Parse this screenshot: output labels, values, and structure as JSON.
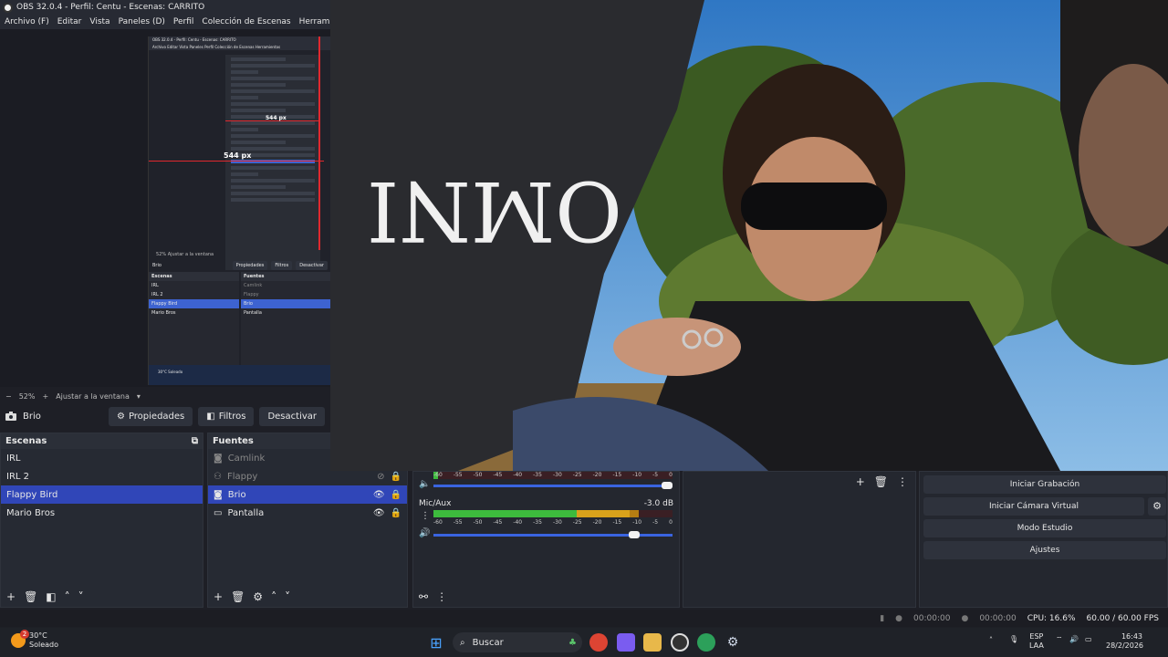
{
  "window": {
    "title": "OBS 32.0.4 - Perfil: Centu - Escenas: CARRITO"
  },
  "menu": [
    "Archivo (F)",
    "Editar",
    "Vista",
    "Paneles (D)",
    "Perfil",
    "Colección de Escenas",
    "Herramientas"
  ],
  "nested_capture": {
    "title": "OBS 32.0.4 - Perfil: Centu - Escenas: CARRITO",
    "menu": "Archivo  Editar  Vista  Paneles  Perfil  Colección de Escenas  Herramientas",
    "measure_label_small": "544 px",
    "measure_label_large": "544 px",
    "zoom_text": "52%   Ajustar a la ventana",
    "source_name": "Brio",
    "buttons": [
      "Propiedades",
      "Filtros",
      "Desactivar"
    ],
    "scenes_header": "Escenas",
    "sources_header": "Fuentes",
    "scenes": [
      "IRL",
      "IRL 2",
      "Flappy Bird",
      "Mario Bros"
    ],
    "sources": [
      "Camlink",
      "Flappy",
      "Brio",
      "Pantalla"
    ],
    "status_temp": "30°C",
    "status_weather": "Soleado"
  },
  "zoom": {
    "minus": "−",
    "value": "52%",
    "plus": "+",
    "fit_label": "Ajustar a la ventana",
    "dropdown": "▾"
  },
  "source_toolbar": {
    "selected_source": "Brio",
    "properties": "Propiedades",
    "filters": "Filtros",
    "deactivate": "Desactivar"
  },
  "scenes": {
    "header": "Escenas",
    "items": [
      "IRL",
      "IRL 2",
      "Flappy Bird",
      "Mario Bros"
    ],
    "selected_index": 2
  },
  "sources": {
    "header": "Fuentes",
    "items": [
      "Camlink",
      "Flappy",
      "Brio",
      "Pantalla"
    ],
    "selected_index": 2
  },
  "mixer": {
    "scale": [
      "-60",
      "-55",
      "-50",
      "-45",
      "-40",
      "-35",
      "-30",
      "-25",
      "-20",
      "-15",
      "-10",
      "-5",
      "0"
    ],
    "channel_name": "Mic/Aux",
    "channel_db": "-3.0 dB"
  },
  "controls": {
    "record": "Iniciar Grabación",
    "virtual_cam": "Iniciar Cámara Virtual",
    "studio_mode": "Modo Estudio",
    "settings": "Ajustes"
  },
  "status": {
    "rec_time": "00:00:00",
    "stream_time": "00:00:00",
    "cpu": "CPU: 16.6%",
    "fps": "60.00 / 60.00 FPS"
  },
  "taskbar": {
    "temperature": "30°C",
    "weather": "Soleado",
    "weather_badge": "2",
    "search_placeholder": "Buscar",
    "lang_top": "ESP",
    "lang_bottom": "LAA",
    "time": "16:43",
    "date": "28/2/2026"
  },
  "colors": {
    "accent": "#3046b8",
    "meter_green": "#3dbb3d",
    "meter_yellow": "#d9a21b",
    "meter_red": "#c0282e",
    "taskbar": "#1f2228"
  }
}
